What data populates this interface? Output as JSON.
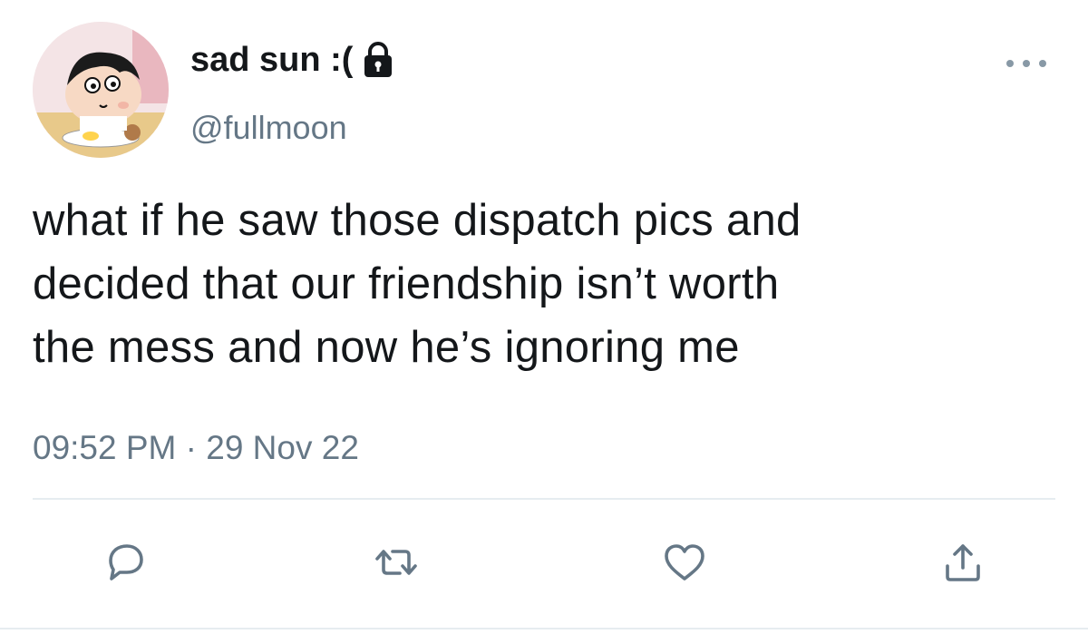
{
  "tweet": {
    "display_name": "sad sun :(",
    "handle": "@fullmoon",
    "text": "what if he saw those dispatch pics and\ndecided that our friendship isn’t worth\nthe mess and now he’s ignoring me",
    "timestamp": "09:52 PM · 29 Nov 22",
    "protected": true
  },
  "icons": {
    "lock": "lock-icon",
    "more": "more-dots-icon",
    "reply": "reply-bubble-icon",
    "retweet": "retweet-icon",
    "like": "heart-icon",
    "share": "share-icon"
  },
  "colors": {
    "text": "#14171a",
    "secondary": "#657786",
    "icon": "#657786",
    "divider": "#e6ecf0",
    "background": "#ffffff"
  }
}
